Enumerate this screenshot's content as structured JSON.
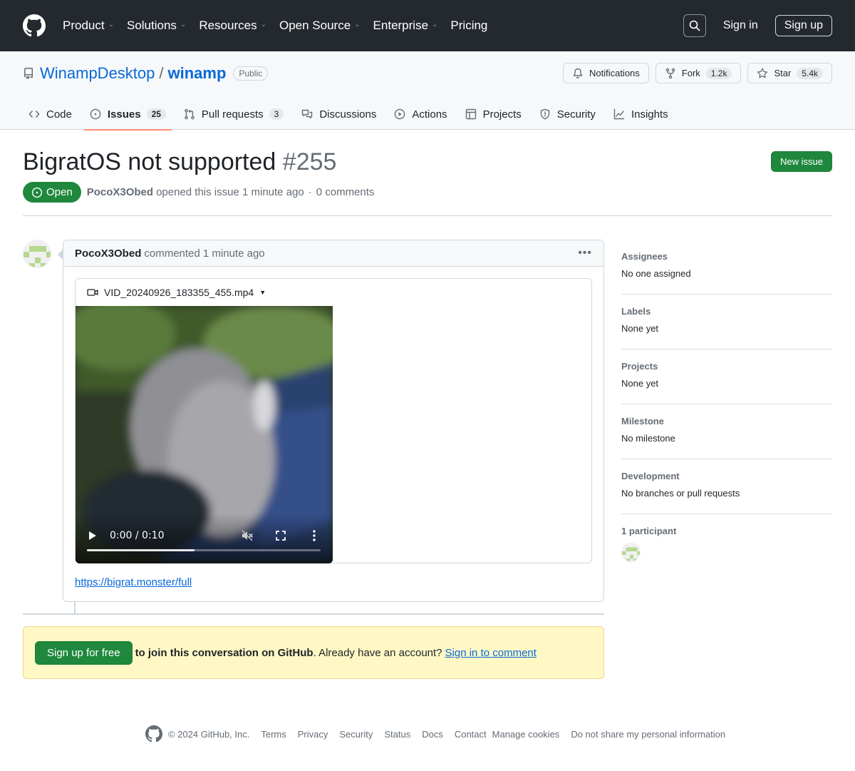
{
  "header": {
    "nav": [
      "Product",
      "Solutions",
      "Resources",
      "Open Source",
      "Enterprise",
      "Pricing"
    ],
    "signin": "Sign in",
    "signup": "Sign up"
  },
  "repo": {
    "owner": "WinampDesktop",
    "separator": "/",
    "name": "winamp",
    "visibility": "Public",
    "notifications": "Notifications",
    "fork_label": "Fork",
    "fork_count": "1.2k",
    "star_label": "Star",
    "star_count": "5.4k",
    "tabs": [
      {
        "label": "Code",
        "icon": "code-icon"
      },
      {
        "label": "Issues",
        "icon": "issue-opened-icon",
        "count": "25",
        "selected": true
      },
      {
        "label": "Pull requests",
        "icon": "pull-request-icon",
        "count": "3"
      },
      {
        "label": "Discussions",
        "icon": "discussions-icon"
      },
      {
        "label": "Actions",
        "icon": "play-icon"
      },
      {
        "label": "Projects",
        "icon": "table-icon"
      },
      {
        "label": "Security",
        "icon": "shield-icon"
      },
      {
        "label": "Insights",
        "icon": "graph-icon"
      }
    ]
  },
  "issue": {
    "title": "BigratOS not supported",
    "number": "#255",
    "new_issue": "New issue",
    "state": "Open",
    "author": "PocoX3Obed",
    "opened_text": "opened this issue 1 minute ago",
    "dot": "·",
    "comments_count": "0 comments"
  },
  "comment": {
    "author": "PocoX3Obed",
    "meta": "commented 1 minute ago",
    "more": "•••",
    "file_name": "VID_20240926_183355_455.mp4",
    "video_time": "0:00 / 0:10",
    "video_buffered": 0.46,
    "link": "https://bigrat.monster/full"
  },
  "banner": {
    "button": "Sign up for free",
    "bold_text": "to join this conversation on GitHub",
    "text": ". Already have an account?",
    "link": "Sign in to comment"
  },
  "sidebar": [
    {
      "heading": "Assignees",
      "value": "No one assigned"
    },
    {
      "heading": "Labels",
      "value": "None yet"
    },
    {
      "heading": "Projects",
      "value": "None yet"
    },
    {
      "heading": "Milestone",
      "value": "No milestone"
    },
    {
      "heading": "Development",
      "value": "No branches or pull requests"
    },
    {
      "heading": "1 participant",
      "value": ""
    }
  ],
  "footer": {
    "copyright": "© 2024 GitHub, Inc.",
    "links": [
      "Terms",
      "Privacy",
      "Security",
      "Status",
      "Docs",
      "Contact",
      "Manage cookies",
      "Do not share my personal information"
    ]
  },
  "colors": {
    "header_bg": "#24292f",
    "primary_green": "#1f883d",
    "link_blue": "#0969da",
    "selected_tab_underline": "#fd8c73",
    "banner_bg": "#fff8c5"
  }
}
